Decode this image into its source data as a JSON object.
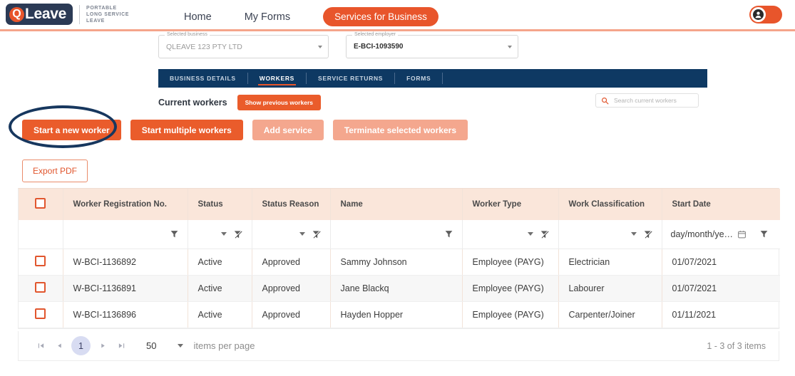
{
  "header": {
    "logo": {
      "mark": "Q",
      "word": "Leave",
      "tagline": "PORTABLE\nLONG SERVICE\nLEAVE",
      "tagline_lines": [
        "PORTABLE",
        "LONG SERVICE",
        "LEAVE"
      ]
    },
    "nav": [
      {
        "label": "Home",
        "style": "link"
      },
      {
        "label": "My Forms",
        "style": "link"
      },
      {
        "label": "Services for Business",
        "style": "pill"
      }
    ],
    "avatar_icon": "user-account-icon"
  },
  "selectors": {
    "business": {
      "label": "Selected business",
      "value": "QLEAVE 123 PTY LTD"
    },
    "employer": {
      "label": "Selected employer",
      "value": "E-BCI-1093590"
    }
  },
  "tabs": [
    {
      "label": "BUSINESS DETAILS",
      "active": false
    },
    {
      "label": "WORKERS",
      "active": true
    },
    {
      "label": "SERVICE RETURNS",
      "active": false
    },
    {
      "label": "FORMS",
      "active": false
    }
  ],
  "toolbar": {
    "current_workers_label": "Current workers",
    "show_previous_label": "Show previous workers",
    "search_placeholder": "Search current workers",
    "search_value": "",
    "search_icon": "search-icon"
  },
  "actions": [
    {
      "label": "Start a new worker",
      "state": "enabled",
      "highlighted": true
    },
    {
      "label": "Start multiple workers",
      "state": "enabled",
      "highlighted": false
    },
    {
      "label": "Add service",
      "state": "disabled",
      "highlighted": false
    },
    {
      "label": "Terminate selected workers",
      "state": "disabled",
      "highlighted": false
    }
  ],
  "export": {
    "label": "Export PDF"
  },
  "grid": {
    "columns": [
      {
        "key": "check",
        "label": "",
        "type": "checkbox"
      },
      {
        "key": "reg",
        "label": "Worker Registration No."
      },
      {
        "key": "status",
        "label": "Status"
      },
      {
        "key": "reason",
        "label": "Status Reason"
      },
      {
        "key": "name",
        "label": "Name"
      },
      {
        "key": "type",
        "label": "Worker Type"
      },
      {
        "key": "classification",
        "label": "Work Classification"
      },
      {
        "key": "start",
        "label": "Start Date"
      }
    ],
    "filter_row": {
      "date_placeholder": "day/month/ye…",
      "calendar_icon": "calendar-icon",
      "filter_icon": "filter-funnel-icon",
      "clear_filter_icon": "clear-filter-icon"
    },
    "rows": [
      {
        "reg": "W-BCI-1136892",
        "status": "Active",
        "reason": "Approved",
        "name": "Sammy Johnson",
        "type": "Employee (PAYG)",
        "classification": "Electrician",
        "start": "01/07/2021"
      },
      {
        "reg": "W-BCI-1136891",
        "status": "Active",
        "reason": "Approved",
        "name": "Jane Blackq",
        "type": "Employee (PAYG)",
        "classification": "Labourer",
        "start": "01/07/2021"
      },
      {
        "reg": "W-BCI-1136896",
        "status": "Active",
        "reason": "Approved",
        "name": "Hayden Hopper",
        "type": "Employee (PAYG)",
        "classification": "Carpenter/Joiner",
        "start": "01/11/2021"
      }
    ]
  },
  "pager": {
    "first_icon": "first-page-icon",
    "prev_icon": "previous-page-icon",
    "current_page": "1",
    "next_icon": "next-page-icon",
    "last_icon": "last-page-icon",
    "page_size": "50",
    "page_size_label": "items per page",
    "summary": "1 - 3 of 3 items"
  },
  "colors": {
    "brand_orange": "#ea5c2b",
    "muted_orange": "#f4a78e",
    "navy": "#0e3963",
    "logo_navy": "#2b3a55",
    "header_peach": "#fae6da",
    "annotation_navy": "#17375e"
  }
}
